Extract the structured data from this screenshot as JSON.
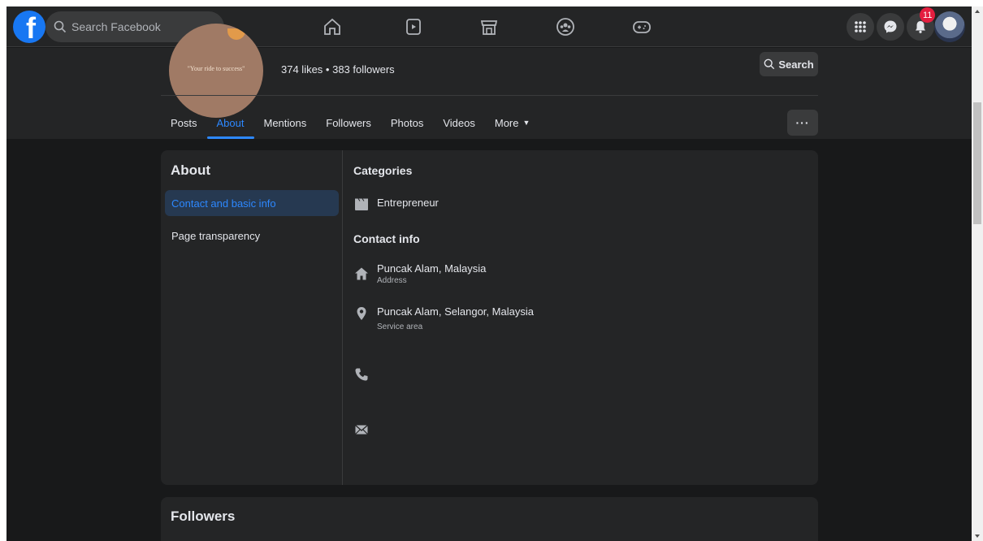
{
  "topbar": {
    "search_placeholder": "Search Facebook",
    "notification_count": "11"
  },
  "header": {
    "profile_slogan": "\"Your ride to success\"",
    "stats": "374 likes • 383 followers",
    "search_button_label": "Search"
  },
  "tabs": [
    {
      "label": "Posts"
    },
    {
      "label": "About"
    },
    {
      "label": "Mentions"
    },
    {
      "label": "Followers"
    },
    {
      "label": "Photos"
    },
    {
      "label": "Videos"
    },
    {
      "label": "More"
    }
  ],
  "about": {
    "title": "About",
    "nav": [
      {
        "label": "Contact and basic info"
      },
      {
        "label": "Page transparency"
      }
    ],
    "categories_title": "Categories",
    "category": "Entrepreneur",
    "contact_title": "Contact info",
    "address": "Puncak Alam, Malaysia",
    "address_label": "Address",
    "service_area": "Puncak Alam, Selangor, Malaysia",
    "service_area_label": "Service area"
  },
  "followers": {
    "title": "Followers"
  },
  "colors": {
    "accent": "#2d88ff",
    "background": "#18191a",
    "surface": "#242526",
    "badge": "#e41e3f"
  }
}
